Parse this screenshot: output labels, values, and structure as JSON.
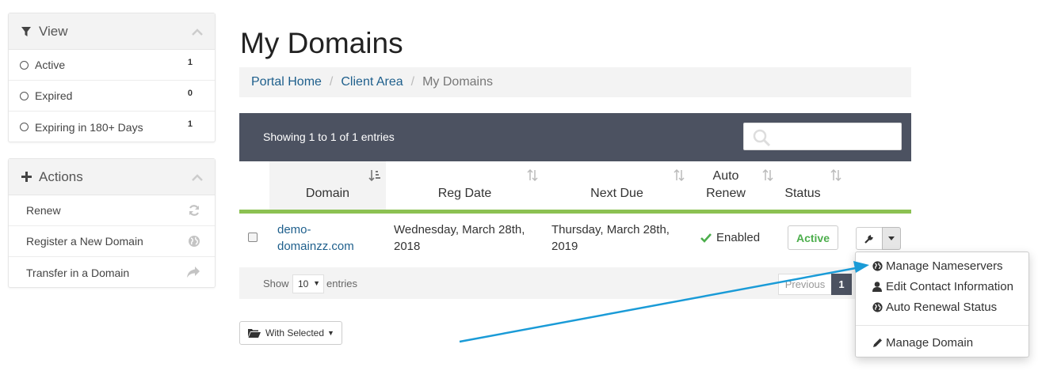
{
  "sidebar": {
    "view_panel": {
      "title": "View",
      "items": [
        {
          "label": "Active",
          "count": "1"
        },
        {
          "label": "Expired",
          "count": "0"
        },
        {
          "label": "Expiring in 180+ Days",
          "count": "1"
        }
      ]
    },
    "actions_panel": {
      "title": "Actions",
      "items": [
        {
          "label": "Renew",
          "icon": "refresh-icon"
        },
        {
          "label": "Register a New Domain",
          "icon": "globe-icon"
        },
        {
          "label": "Transfer in a Domain",
          "icon": "share-icon"
        }
      ]
    }
  },
  "page": {
    "title": "My Domains",
    "breadcrumb": [
      "Portal Home",
      "Client Area",
      "My Domains"
    ]
  },
  "table": {
    "entries_info": "Showing 1 to 1 of 1 entries",
    "columns": {
      "domain": "Domain",
      "reg_date": "Reg Date",
      "next_due": "Next Due",
      "auto_renew_line1": "Auto",
      "auto_renew_line2": "Renew",
      "status": "Status"
    },
    "rows": [
      {
        "domain_line1": "demo-",
        "domain_line2": "domainzz.com",
        "reg_date_line1": "Wednesday, March 28th,",
        "reg_date_line2": "2018",
        "next_due_line1": "Thursday, March 28th,",
        "next_due_line2": "2019",
        "auto_renew": "Enabled",
        "status": "Active"
      }
    ],
    "footer": {
      "show_label": "Show",
      "length_value": "10",
      "entries_label": "entries",
      "previous_label": "Previous",
      "current_page": "1"
    },
    "with_selected_label": "With Selected"
  },
  "dropdown": {
    "items": [
      {
        "label": "Manage Nameservers",
        "icon": "globe-icon"
      },
      {
        "label": "Edit Contact Information",
        "icon": "user-icon"
      },
      {
        "label": "Auto Renewal Status",
        "icon": "globe-icon"
      },
      {
        "label": "Manage Domain",
        "icon": "pencil-icon"
      }
    ]
  },
  "colors": {
    "accent_green": "#8cc152",
    "header_dark": "#4c5261",
    "link_blue": "#1e5f8c",
    "annotation_arrow": "#1a9bd7"
  }
}
